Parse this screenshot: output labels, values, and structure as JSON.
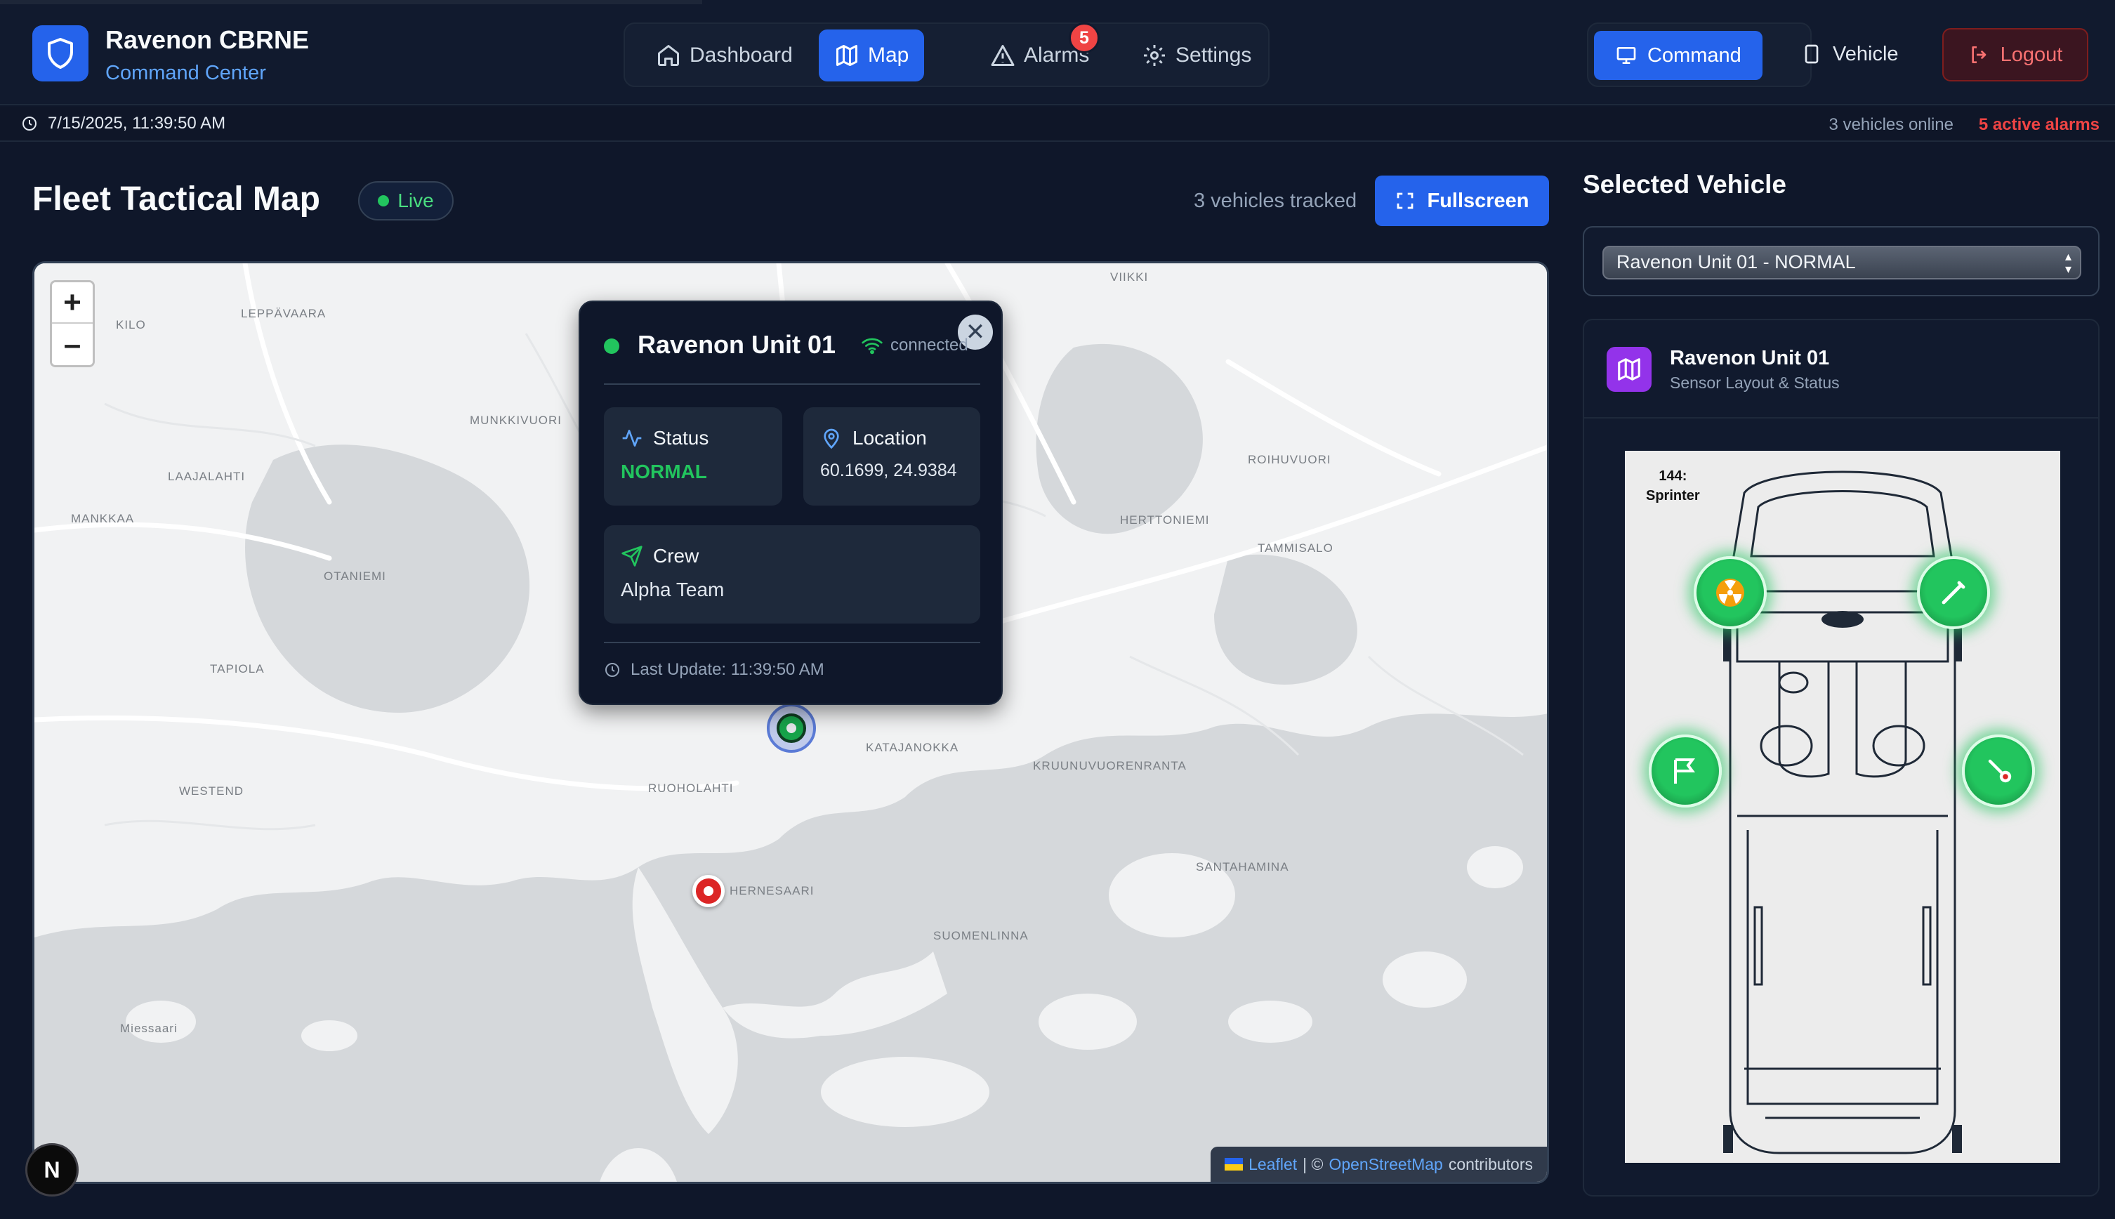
{
  "brand": {
    "title": "Ravenon CBRNE",
    "subtitle": "Command Center",
    "icon": "shield-icon"
  },
  "nav": {
    "items": [
      {
        "label": "Dashboard",
        "icon": "home-icon",
        "active": false
      },
      {
        "label": "Map",
        "icon": "map-icon",
        "active": true
      },
      {
        "label": "Alarms",
        "icon": "alert-triangle-icon",
        "active": false,
        "badge": "5"
      },
      {
        "label": "Settings",
        "icon": "gear-icon",
        "active": false
      }
    ]
  },
  "mode": {
    "command_label": "Command",
    "vehicle_label": "Vehicle",
    "active": "Command"
  },
  "logout_label": "Logout",
  "status": {
    "timestamp": "7/15/2025, 11:39:50 AM",
    "online": "3 vehicles online",
    "alarms": "5 active alarms"
  },
  "main": {
    "title": "Fleet Tactical Map",
    "live_label": "Live",
    "tracked": "3 vehicles tracked",
    "fullscreen_label": "Fullscreen"
  },
  "map": {
    "zoom_in": "+",
    "zoom_out": "–",
    "places": [
      "VIIKKI",
      "KILO",
      "LEPPÄVAARA",
      "MUNKKIVUORI",
      "LAAJALAHTI",
      "MANKKAA",
      "OTANIEMI",
      "TAPIOLA",
      "WESTEND",
      "ROIHUVUORI",
      "HERTTONIEMI",
      "TAMMISALO",
      "KATAJANOKKA",
      "RUOHOLAHTI",
      "KRUUNUVUORENRANTA",
      "HERNESAARI",
      "SANTAHAMINA",
      "SUOMENLINNA",
      "Miessaari"
    ],
    "attribution": {
      "leaflet": "Leaflet",
      "sep": "| ©",
      "osm": "OpenStreetMap",
      "suffix": "contributors"
    },
    "n_badge": "N"
  },
  "popup": {
    "title": "Ravenon Unit 01",
    "connection": "connected",
    "status_label": "Status",
    "status_value": "NORMAL",
    "location_label": "Location",
    "location_value": "60.1699, 24.9384",
    "crew_label": "Crew",
    "crew_value": "Alpha Team",
    "last_update": "Last Update: 11:39:50 AM",
    "close": "✕"
  },
  "panel": {
    "title": "Selected Vehicle",
    "select_value": "Ravenon Unit 01 - NORMAL",
    "unit_name": "Ravenon Unit 01",
    "unit_sub": "Sensor Layout & Status",
    "layout_caption_1": "144:",
    "layout_caption_2": "Sprinter",
    "sensors": [
      {
        "icon": "radiation-icon",
        "status": "normal"
      },
      {
        "icon": "wand-icon",
        "status": "normal"
      },
      {
        "icon": "biohazard-flag-icon",
        "status": "normal"
      },
      {
        "icon": "thermometer-icon",
        "status": "normal"
      }
    ]
  },
  "colors": {
    "accent": "#2563eb",
    "ok": "#22c55e",
    "danger": "#ef4444",
    "bg": "#0f172a"
  }
}
